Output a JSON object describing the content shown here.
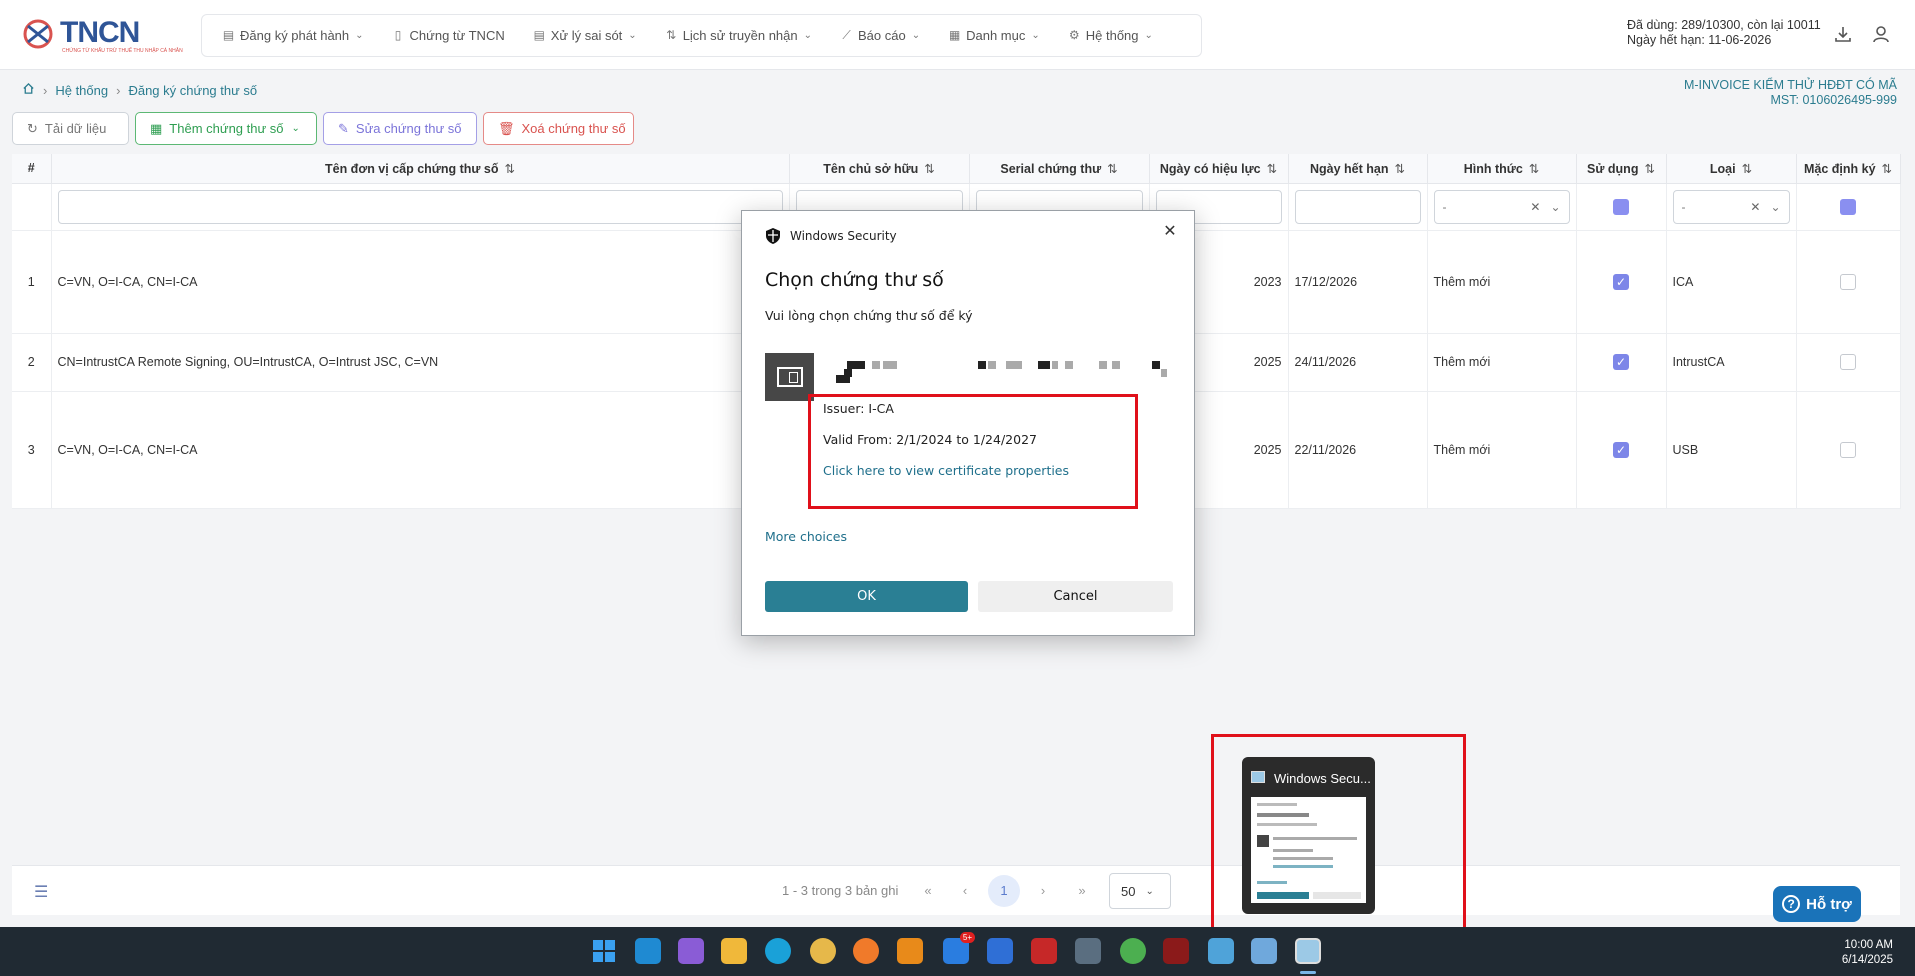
{
  "header": {
    "logo_text": "TNCN",
    "logo_subtitle": "CHỨNG TỪ KHẤU TRỪ THUẾ THU NHẬP CÁ NHÂN",
    "nav": [
      {
        "label": "Đăng ký phát hành",
        "icon": "document-icon",
        "has_dropdown": true
      },
      {
        "label": "Chứng từ TNCN",
        "icon": "file-icon",
        "has_dropdown": false
      },
      {
        "label": "Xử lý sai sót",
        "icon": "edit-document-icon",
        "has_dropdown": true
      },
      {
        "label": "Lịch sử truyền nhận",
        "icon": "transfer-icon",
        "has_dropdown": true
      },
      {
        "label": "Báo cáo",
        "icon": "chart-icon",
        "has_dropdown": true
      },
      {
        "label": "Danh mục",
        "icon": "grid-icon",
        "has_dropdown": true
      },
      {
        "label": "Hệ thống",
        "icon": "gear-icon",
        "has_dropdown": true
      }
    ],
    "usage_line1": "Đã dùng: 289/10300, còn lại 10011",
    "usage_line2": "Ngày hết hạn: 11-06-2026"
  },
  "breadcrumb": [
    "Hệ thống",
    "Đăng ký chứng thư số"
  ],
  "company": {
    "name": "M-INVOICE KIỂM THỬ HĐĐT CÓ MÃ",
    "tax_code": "MST: 0106026495-999"
  },
  "toolbar": {
    "reload": "Tải dữ liệu",
    "add": "Thêm chứng thư số",
    "edit": "Sửa chứng thư số",
    "delete": "Xoá chứng thư số"
  },
  "table": {
    "headers": [
      "#",
      "Tên đơn vị cấp chứng thư số",
      "Tên chủ sở hữu",
      "Serial chứng thư",
      "Ngày có hiệu lực",
      "Ngày hết hạn",
      "Hình thức",
      "Sử dụng",
      "Loại",
      "Mặc định ký"
    ],
    "filter_select_placeholder": "-",
    "rows": [
      {
        "no": "1",
        "issuer": "C=VN, O=I-CA, CN=I-CA",
        "owner": "",
        "serial": "",
        "valid_from": "2023",
        "valid_to": "17/12/2026",
        "form": "Thêm mới",
        "in_use": true,
        "type": "ICA",
        "default": false
      },
      {
        "no": "2",
        "issuer": "CN=IntrustCA Remote Signing, OU=IntrustCA, O=Intrust JSC, C=VN",
        "owner": "",
        "serial": "",
        "valid_from": "2025",
        "valid_to": "24/11/2026",
        "form": "Thêm mới",
        "in_use": true,
        "type": "IntrustCA",
        "default": false
      },
      {
        "no": "3",
        "issuer": "C=VN, O=I-CA, CN=I-CA",
        "owner": "",
        "serial": "",
        "valid_from": "2025",
        "valid_to": "22/11/2026",
        "form": "Thêm mới",
        "in_use": true,
        "type": "USB",
        "default": false
      }
    ]
  },
  "pager": {
    "summary": "1 - 3 trong 3 bản ghi",
    "current_page": "1",
    "page_size": "50"
  },
  "help_button": "Hỗ trợ",
  "dialog": {
    "app": "Windows Security",
    "title": "Chọn chứng thư số",
    "subtitle": "Vui lòng chọn chứng thư số để ký",
    "issuer": "Issuer: I-CA",
    "valid": "Valid From: 2/1/2024 to 1/24/2027",
    "link": "Click here to view certificate properties",
    "more": "More choices",
    "ok": "OK",
    "cancel": "Cancel"
  },
  "taskbar": {
    "thumbnail_title": "Windows Secu...",
    "time": "10:00 AM",
    "date": "6/14/2025",
    "badge": "5+"
  },
  "colors": {
    "accent": "#2a7f94",
    "highlight_box": "#e0101a",
    "checkbox": "#7d86e8",
    "add": "#2e9e51",
    "edit": "#7b74d9",
    "delete": "#d9534f"
  }
}
